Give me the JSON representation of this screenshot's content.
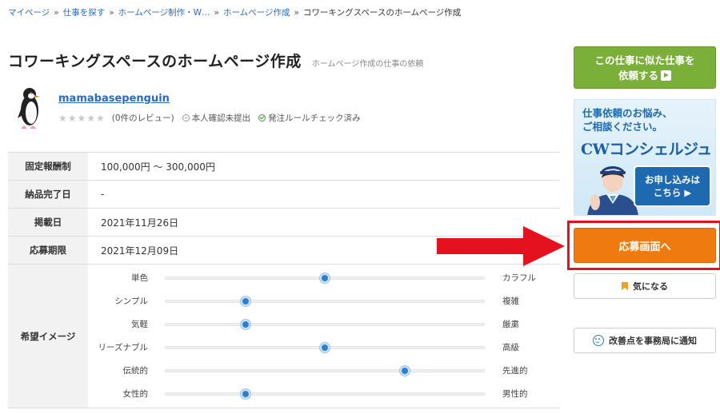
{
  "breadcrumb": [
    {
      "label": "マイページ"
    },
    {
      "label": "仕事を探す"
    },
    {
      "label": "ホームページ制作・W…"
    },
    {
      "label": "ホームページ作成"
    },
    {
      "label": "コワーキングスペースのホームページ作成"
    }
  ],
  "breadcrumb_sep": "»",
  "job": {
    "title": "コワーキングスペースのホームページ作成",
    "subtitle": "ホームページ作成の仕事の依頼"
  },
  "client": {
    "name": "mamabasepenguin",
    "stars": "★★★★★",
    "reviews": "(0件のレビュー)",
    "identity_status": "本人確認未提出",
    "rule_check": "発注ルールチェック済み"
  },
  "details": [
    {
      "label": "固定報酬制",
      "value": "100,000円 ～ 300,000円"
    },
    {
      "label": "納品完了日",
      "value": "-"
    },
    {
      "label": "掲載日",
      "value": "2021年11月26日"
    },
    {
      "label": "応募期限",
      "value": "2021年12月09日"
    }
  ],
  "image": {
    "label": "希望イメージ",
    "sliders": [
      {
        "left": "単色",
        "right": "カラフル",
        "level": 0.5
      },
      {
        "left": "シンプル",
        "right": "複雑",
        "level": 0.25
      },
      {
        "left": "気軽",
        "right": "厳粛",
        "level": 0.25
      },
      {
        "left": "リーズナブル",
        "right": "高級",
        "level": 0.5
      },
      {
        "left": "伝統的",
        "right": "先進的",
        "level": 0.75
      },
      {
        "left": "女性的",
        "right": "男性的",
        "level": 0.25
      }
    ]
  },
  "sidebar": {
    "similar_line1": "この仕事に似た仕事を",
    "similar_line2": "依頼する",
    "banner_line1": "仕事依頼のお悩み、",
    "banner_line2": "ご相談ください。",
    "banner_logo": "CWコンシェルジュ",
    "banner_cta_line1": "お申し込みは",
    "banner_cta_line2": "こちら ▶",
    "apply_label": "応募画面へ",
    "favorite_label": "気になる",
    "report_label": "改善点を事務局に通知"
  },
  "colors": {
    "link": "#2a6bbf",
    "similar_button": "#7ab03a",
    "apply_button": "#ee7a10",
    "highlight": "#e4121f",
    "slider_knob": "#2f7fd0"
  },
  "icons": [
    "penguin-avatar",
    "bookmark-icon",
    "smile-icon",
    "play-icon",
    "arrow-annotation"
  ]
}
